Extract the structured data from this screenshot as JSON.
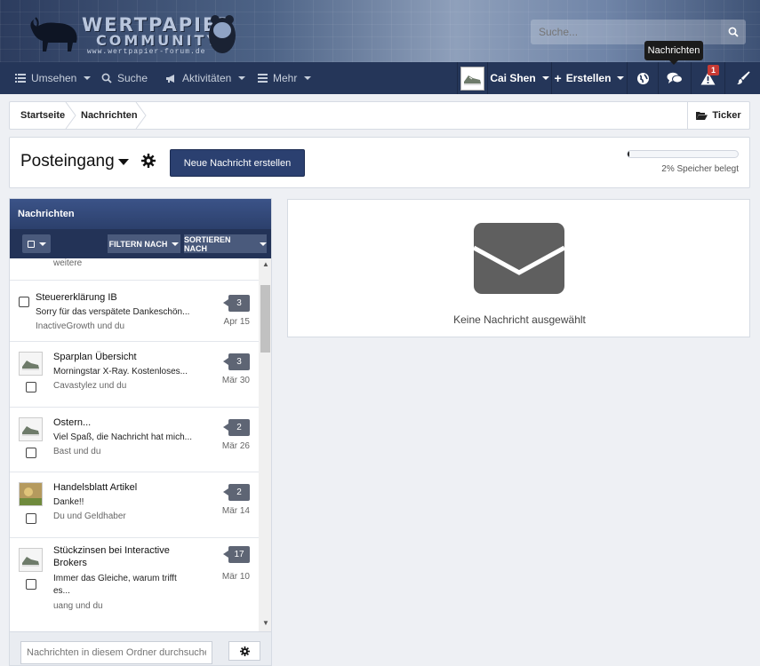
{
  "header": {
    "logo_line1": "WERTPAPIER",
    "logo_line2": "COMMUNITY",
    "logo_line3": "www.wertpapier-forum.de",
    "search_placeholder": "Suche...",
    "tooltip": "Nachrichten"
  },
  "nav": {
    "items": [
      {
        "label": "Umsehen",
        "icon": "list-icon"
      },
      {
        "label": "Suche",
        "icon": "search-icon"
      },
      {
        "label": "Aktivitäten",
        "icon": "megaphone-icon"
      },
      {
        "label": "Mehr",
        "icon": "menu-icon"
      }
    ],
    "user_name": "Cai Shen",
    "create_label": "Erstellen",
    "notification_count": "1"
  },
  "breadcrumb": {
    "items": [
      "Startseite",
      "Nachrichten"
    ],
    "ticker_label": "Ticker"
  },
  "folder": {
    "title": "Posteingang",
    "new_button": "Neue Nachricht erstellen",
    "storage_percent": 2,
    "storage_text": "2% Speicher belegt"
  },
  "messages_panel": {
    "title": "Nachrichten",
    "filter_label": "FILTERN NACH",
    "sort_label": "SORTIEREN NACH",
    "partial_top": "weitere",
    "items": [
      {
        "title": "Steuererklärung IB",
        "snippet": "Sorry für das verspätete Dankeschön...",
        "participants": "InactiveGrowth und du",
        "count": "3",
        "date": "Apr 15"
      },
      {
        "title": "Sparplan Übersicht",
        "snippet": "Morningstar X-Ray. Kostenloses...",
        "participants": "Cavastylez und du",
        "count": "3",
        "date": "Mär 30"
      },
      {
        "title": "Ostern...",
        "snippet": "Viel Spaß, die Nachricht hat mich...",
        "participants": "Bast und du",
        "count": "2",
        "date": "Mär 26"
      },
      {
        "title": "Handelsblatt Artikel",
        "snippet": "Danke!!",
        "participants": "Du und Geldhaber",
        "count": "2",
        "date": "Mär 14"
      },
      {
        "title_line1": "Stückzinsen bei Interactive",
        "title_line2": "Brokers",
        "snippet_line1": "Immer das Gleiche, warum trifft",
        "snippet_line2": "es...",
        "participants": "uang und du",
        "count": "17",
        "date": "Mär 10"
      }
    ],
    "search_placeholder": "Nachrichten in diesem Ordner durchsuche"
  },
  "detail": {
    "empty_text": "Keine Nachricht ausgewählt"
  }
}
